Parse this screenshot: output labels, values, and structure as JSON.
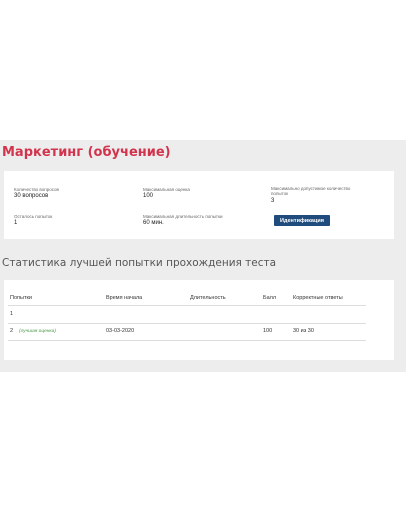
{
  "page": {
    "title": "Маркетинг (обучение)",
    "subtitle": "Статистика лучшей попытки прохождения теста"
  },
  "info": {
    "questions_label": "Количество вопросов",
    "questions_value": "30 вопросов",
    "max_score_label": "Максимальная оценка",
    "max_score_value": "100",
    "max_attempts_label": "Максимально допустимое количество попыток",
    "max_attempts_value": "3",
    "attempts_left_label": "Осталось попыток",
    "attempts_left_value": "1",
    "max_duration_label": "Максимальная длительность попытки",
    "max_duration_value": "60 мин.",
    "identify_button": "Идентификация"
  },
  "table": {
    "columns": [
      "Попытки",
      "Время начала",
      "Длительность",
      "Балл",
      "Корректные ответы"
    ],
    "rows": [
      {
        "attempt": "1",
        "note": "",
        "start": "",
        "duration": "",
        "score": "",
        "correct": ""
      },
      {
        "attempt": "2",
        "note": "(лучшая оценка)",
        "start": "03-03-2020",
        "duration": "",
        "score": "100",
        "correct": "30 из 30"
      }
    ]
  },
  "colors": {
    "title": "#d2344d",
    "button": "#1f4c7c",
    "best_note": "#4a9a4a",
    "panel_bg": "#ededed"
  }
}
